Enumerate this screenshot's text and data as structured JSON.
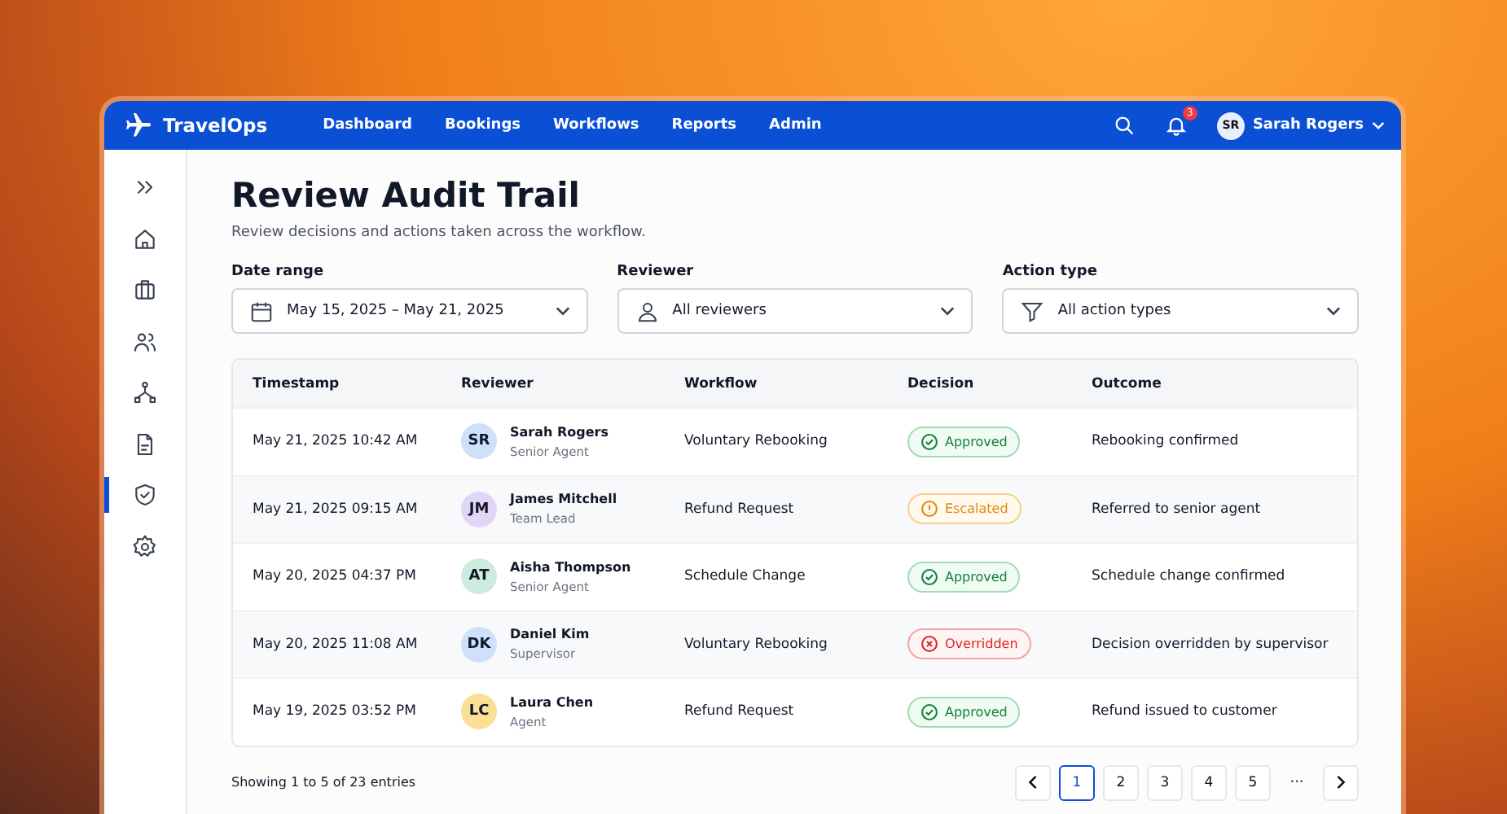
{
  "topbar": {
    "brand": "TravelOps",
    "nav": [
      {
        "label": "Dashboard",
        "selected": false
      },
      {
        "label": "Bookings",
        "selected": false
      },
      {
        "label": "Workflows",
        "selected": false
      },
      {
        "label": "Reports",
        "selected": false
      },
      {
        "label": "Admin",
        "selected": false
      }
    ],
    "notifications": "3",
    "user": {
      "initials": "SR",
      "name": "Sarah Rogers"
    }
  },
  "sidebar": {
    "items": [
      {
        "kind": "expand",
        "selected": false
      },
      {
        "kind": "home",
        "selected": false
      },
      {
        "kind": "briefcase",
        "selected": false
      },
      {
        "kind": "users",
        "selected": false
      },
      {
        "kind": "flow",
        "selected": false
      },
      {
        "kind": "document",
        "selected": false
      },
      {
        "kind": "shield",
        "selected": true
      },
      {
        "kind": "settings",
        "selected": false
      }
    ]
  },
  "page": {
    "title": "Review Audit Trail",
    "subtitle": "Review decisions and actions taken across the workflow."
  },
  "filters": [
    {
      "kind": "date",
      "label": "Date range",
      "value": "May 15, 2025 – May 21, 2025"
    },
    {
      "kind": "person",
      "label": "Reviewer",
      "value": "All reviewers"
    },
    {
      "kind": "filter",
      "label": "Action type",
      "value": "All action types"
    }
  ],
  "table": {
    "columns": [
      "Timestamp",
      "Reviewer",
      "Workflow",
      "Decision",
      "Outcome"
    ],
    "rows": [
      {
        "timestamp": "May 21, 2025 10:42 AM",
        "initials": "SR",
        "color": "#cfe0fb",
        "name": "Sarah Rogers",
        "role": "Senior Agent",
        "workflow": "Voluntary Rebooking",
        "decision": {
          "kind": "approved",
          "label": "Approved"
        },
        "outcome": "Rebooking confirmed"
      },
      {
        "timestamp": "May 21, 2025 09:15 AM",
        "initials": "JM",
        "color": "#e2d6f7",
        "name": "James Mitchell",
        "role": "Team Lead",
        "workflow": "Refund Request",
        "decision": {
          "kind": "escalated",
          "label": "Escalated"
        },
        "outcome": "Referred to senior agent"
      },
      {
        "timestamp": "May 20, 2025 04:37 PM",
        "initials": "AT",
        "color": "#cdebdf",
        "name": "Aisha Thompson",
        "role": "Senior Agent",
        "workflow": "Schedule Change",
        "decision": {
          "kind": "approved",
          "label": "Approved"
        },
        "outcome": "Schedule change confirmed"
      },
      {
        "timestamp": "May 20, 2025 11:08 AM",
        "initials": "DK",
        "color": "#cfe0fb",
        "name": "Daniel Kim",
        "role": "Supervisor",
        "workflow": "Voluntary Rebooking",
        "decision": {
          "kind": "overridden",
          "label": "Overridden"
        },
        "outcome": "Decision overridden by supervisor"
      },
      {
        "timestamp": "May 19, 2025 03:52 PM",
        "initials": "LC",
        "color": "#fbdf95",
        "name": "Laura Chen",
        "role": "Agent",
        "workflow": "Refund Request",
        "decision": {
          "kind": "approved",
          "label": "Approved"
        },
        "outcome": "Refund issued to customer"
      }
    ]
  },
  "footer": {
    "summary": "Showing 1 to 5 of 23 entries",
    "pages": [
      {
        "label": "1",
        "selected": true
      },
      {
        "label": "2",
        "selected": false
      },
      {
        "label": "3",
        "selected": false
      },
      {
        "label": "4",
        "selected": false
      },
      {
        "label": "5",
        "selected": false
      }
    ],
    "ellipsis": "···"
  }
}
